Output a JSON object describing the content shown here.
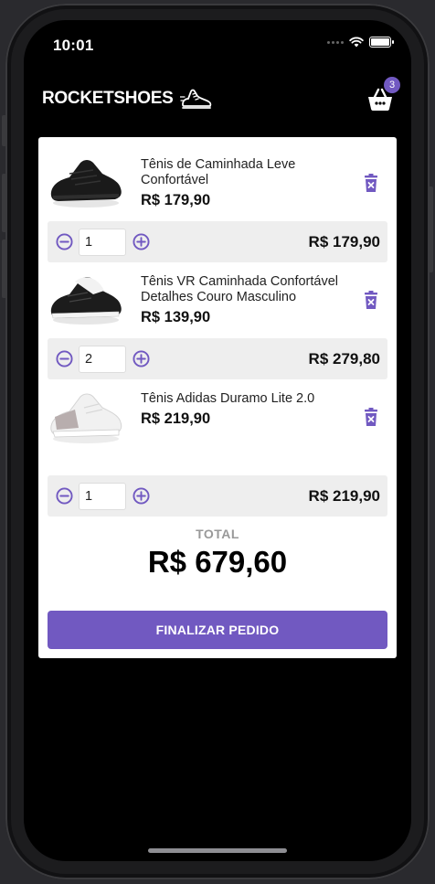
{
  "status": {
    "time": "10:01"
  },
  "header": {
    "brand": "ROCKETSHOES",
    "cart_count": "3"
  },
  "cart": {
    "items": [
      {
        "title": "Tênis de Caminhada Leve Confortável",
        "price": "R$ 179,90",
        "quantity": "1",
        "subtotal": "R$ 179,90",
        "image": "black-sneaker"
      },
      {
        "title": "Tênis VR Caminhada Confortável Detalhes Couro Masculino",
        "price": "R$ 139,90",
        "quantity": "2",
        "subtotal": "R$ 279,80",
        "image": "black-white-sneaker"
      },
      {
        "title": "Tênis Adidas Duramo Lite 2.0",
        "price": "R$ 219,90",
        "quantity": "1",
        "subtotal": "R$ 219,90",
        "image": "white-sneaker"
      }
    ],
    "total_label": "TOTAL",
    "total_value": "R$ 679,60",
    "checkout_label": "FINALIZAR PEDIDO"
  },
  "colors": {
    "accent": "#7159c1",
    "background": "#000000",
    "card": "#ffffff",
    "item_bar": "#eeeeee"
  },
  "icons": [
    "shoe-logo-icon",
    "shopping-basket-icon",
    "trash-icon",
    "minus-circle-icon",
    "plus-circle-icon"
  ]
}
